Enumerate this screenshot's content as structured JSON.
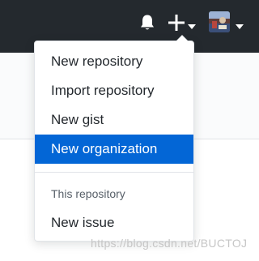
{
  "header": {
    "icons": [
      "bell-icon",
      "plus-icon",
      "chevron-down-icon",
      "avatar"
    ],
    "colors": {
      "bar": "#24292e",
      "icon": "#ffffff"
    }
  },
  "dropdown": {
    "items": [
      {
        "label": "New repository"
      },
      {
        "label": "Import repository"
      },
      {
        "label": "New gist"
      },
      {
        "label": "New organization",
        "selected": true
      }
    ],
    "section_header": "This repository",
    "section_items": [
      {
        "label": "New issue"
      }
    ],
    "colors": {
      "selected_bg": "#0366d6",
      "selected_text": "#ffffff",
      "text": "#24292e",
      "muted": "#586069"
    }
  },
  "watermark": "https://blog.csdn.net/BUCTOJ"
}
